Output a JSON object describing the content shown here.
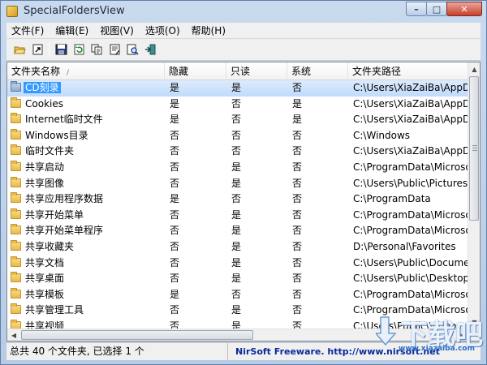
{
  "window": {
    "title": "SpecialFoldersView",
    "controls": {
      "minimize": "–",
      "maximize": "□",
      "close": "✕"
    }
  },
  "menu": {
    "items": [
      "文件(F)",
      "编辑(E)",
      "视图(V)",
      "选项(O)",
      "帮助(H)"
    ]
  },
  "toolbar": {
    "buttons": [
      "open-folder-icon",
      "shortcut-icon",
      "save-icon",
      "refresh-icon",
      "copy-icon",
      "properties-icon",
      "find-icon",
      "exit-icon"
    ]
  },
  "table": {
    "columns": [
      "文件夹名称",
      "隐藏",
      "只读",
      "系统",
      "文件夹路径"
    ],
    "sorted_column_marker": "/",
    "rows": [
      {
        "name": "CD刻录",
        "hidden": "是",
        "readonly": "是",
        "system": "否",
        "path": "C:\\Users\\XiaZaiBa\\AppData",
        "icon": "cd",
        "selected": true
      },
      {
        "name": "Cookies",
        "hidden": "是",
        "readonly": "否",
        "system": "是",
        "path": "C:\\Users\\XiaZaiBa\\AppData",
        "icon": "folder"
      },
      {
        "name": "Internet临时文件",
        "hidden": "是",
        "readonly": "否",
        "system": "是",
        "path": "C:\\Users\\XiaZaiBa\\AppData",
        "icon": "folder"
      },
      {
        "name": "Windows目录",
        "hidden": "否",
        "readonly": "否",
        "system": "否",
        "path": "C:\\Windows",
        "icon": "folder"
      },
      {
        "name": "临时文件夹",
        "hidden": "否",
        "readonly": "否",
        "system": "否",
        "path": "C:\\Users\\XiaZaiBa\\AppData",
        "icon": "folder"
      },
      {
        "name": "共享启动",
        "hidden": "否",
        "readonly": "是",
        "system": "否",
        "path": "C:\\ProgramData\\Microsoft\\",
        "icon": "folder"
      },
      {
        "name": "共享图像",
        "hidden": "否",
        "readonly": "是",
        "system": "否",
        "path": "C:\\Users\\Public\\Pictures",
        "icon": "folder"
      },
      {
        "name": "共享应用程序数据",
        "hidden": "是",
        "readonly": "否",
        "system": "否",
        "path": "C:\\ProgramData",
        "icon": "folder"
      },
      {
        "name": "共享开始菜单",
        "hidden": "否",
        "readonly": "是",
        "system": "否",
        "path": "C:\\ProgramData\\Microsoft\\",
        "icon": "folder"
      },
      {
        "name": "共享开始菜单程序",
        "hidden": "否",
        "readonly": "是",
        "system": "否",
        "path": "C:\\ProgramData\\Microsoft\\",
        "icon": "folder"
      },
      {
        "name": "共享收藏夹",
        "hidden": "否",
        "readonly": "是",
        "system": "否",
        "path": "D:\\Personal\\Favorites",
        "icon": "fav"
      },
      {
        "name": "共享文档",
        "hidden": "否",
        "readonly": "是",
        "system": "否",
        "path": "C:\\Users\\Public\\Documents",
        "icon": "folder"
      },
      {
        "name": "共享桌面",
        "hidden": "否",
        "readonly": "是",
        "system": "否",
        "path": "C:\\Users\\Public\\Desktop",
        "icon": "folder"
      },
      {
        "name": "共享模板",
        "hidden": "是",
        "readonly": "否",
        "system": "否",
        "path": "C:\\ProgramData\\Microsoft\\",
        "icon": "folder"
      },
      {
        "name": "共享管理工具",
        "hidden": "否",
        "readonly": "是",
        "system": "否",
        "path": "C:\\ProgramData\\Microsoft\\",
        "icon": "folder"
      },
      {
        "name": "共享视频",
        "hidden": "否",
        "readonly": "是",
        "system": "否",
        "path": "C:\\Users\\Public\\Videos",
        "icon": "folder"
      }
    ]
  },
  "status": {
    "left": "总共 40 个文件夹, 已选择 1 个",
    "link": "NirSoft Freeware.  http://www.nirsoft.net"
  },
  "watermark": {
    "text": "下载吧",
    "url": "www.xiazaiba.com"
  },
  "colors": {
    "selection": "#3399ff",
    "title_frame": "#b7cbe5",
    "link": "#0a2a9a"
  }
}
